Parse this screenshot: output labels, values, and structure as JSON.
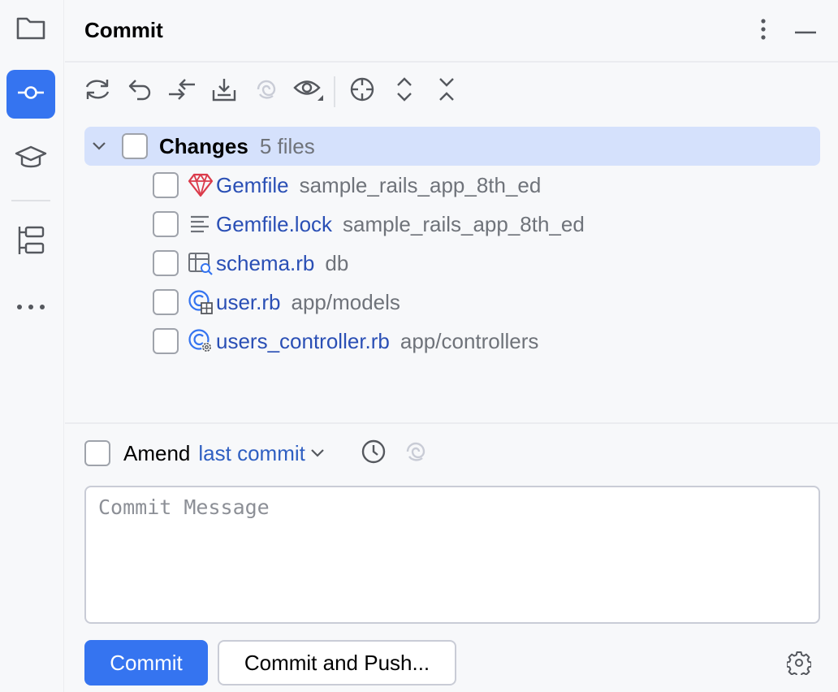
{
  "sidebar": {
    "items": [
      {
        "name": "project",
        "icon": "folder-icon"
      },
      {
        "name": "commit",
        "icon": "commit-icon",
        "active": true
      },
      {
        "name": "learn",
        "icon": "graduation-cap-icon"
      },
      {
        "name": "structure",
        "icon": "structure-icon"
      },
      {
        "name": "more",
        "icon": "more-horizontal-icon"
      }
    ]
  },
  "header": {
    "title": "Commit"
  },
  "toolbar": {
    "items": [
      "refresh-icon",
      "rollback-icon",
      "diff-icon",
      "shelve-icon",
      "ai-icon",
      "view-options-icon",
      "locate-icon",
      "expand-all-icon",
      "collapse-all-icon"
    ]
  },
  "changes": {
    "group_label": "Changes",
    "group_count": "5 files",
    "files": [
      {
        "name": "Gemfile",
        "path": "sample_rails_app_8th_ed",
        "icon": "ruby-gem-icon"
      },
      {
        "name": "Gemfile.lock",
        "path": "sample_rails_app_8th_ed",
        "icon": "text-file-icon"
      },
      {
        "name": "schema.rb",
        "path": "db",
        "icon": "database-schema-icon"
      },
      {
        "name": "user.rb",
        "path": "app/models",
        "icon": "ruby-model-icon"
      },
      {
        "name": "users_controller.rb",
        "path": "app/controllers",
        "icon": "ruby-controller-icon"
      }
    ]
  },
  "amend": {
    "label": "Amend",
    "link": "last commit"
  },
  "message": {
    "placeholder": "Commit Message",
    "value": ""
  },
  "actions": {
    "commit_label": "Commit",
    "commit_push_label": "Commit and Push..."
  },
  "colors": {
    "accent": "#3574f0",
    "selection": "#d5e1fc",
    "file_name": "#2a4fb5",
    "path": "#6f737a",
    "ruby_red": "#db3b4b"
  }
}
